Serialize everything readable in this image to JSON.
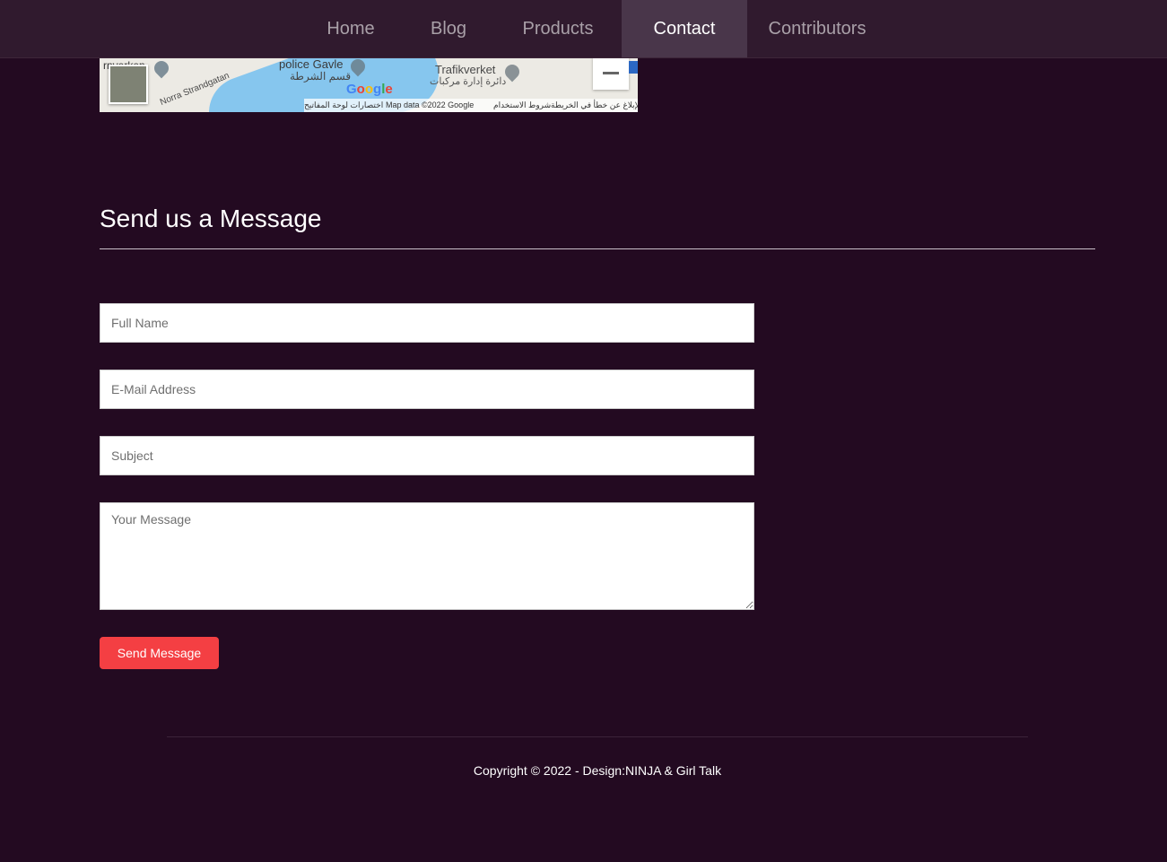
{
  "nav": {
    "items": [
      {
        "label": "Home",
        "active": false
      },
      {
        "label": "Blog",
        "active": false
      },
      {
        "label": "Products",
        "active": false
      },
      {
        "label": "Contact",
        "active": true
      },
      {
        "label": "Contributors",
        "active": false
      }
    ]
  },
  "map": {
    "labels": {
      "police": "police Gavle",
      "police_ar": "قسم الشرطة",
      "trafikverket": "Trafikverket",
      "trafikverket_ar": "دائرة إدارة مركبات",
      "street": "Norra Strandgatan",
      "partial": "rnverken"
    },
    "google": "Google",
    "footer": {
      "shortcuts": "اختصارات لوحة المفاتيح",
      "map_data": "Map data ©2022 Google",
      "terms": "شروط الاستخدام",
      "report": "الإبلاغ عن خطأ في الخريطة"
    }
  },
  "contact": {
    "heading": "Send us a Message",
    "fields": {
      "full_name": "Full Name",
      "email": "E-Mail Address",
      "subject": "Subject",
      "message": "Your Message"
    },
    "submit_label": "Send Message"
  },
  "footer": {
    "copyright": "Copyright © 2022 - Design:NINJA & Girl Talk"
  },
  "colors": {
    "background": "#230a21",
    "navbar": "#301a2e",
    "nav_active": "#49364a",
    "button": "#f43f43"
  }
}
